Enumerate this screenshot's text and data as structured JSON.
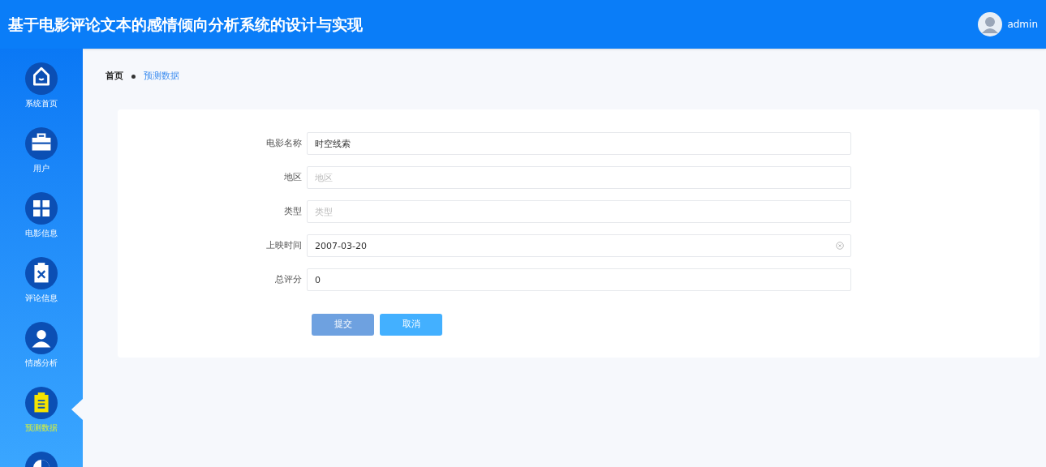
{
  "header": {
    "title": "基于电影评论文本的感情倾向分析系统的设计与实现",
    "user": "admin"
  },
  "sidebar": {
    "items": [
      {
        "label": "系统首页",
        "kind": "home",
        "selected": false
      },
      {
        "label": "用户",
        "kind": "briefcase",
        "selected": false
      },
      {
        "label": "电影信息",
        "kind": "grid",
        "selected": false
      },
      {
        "label": "评论信息",
        "kind": "clipboardx",
        "selected": false
      },
      {
        "label": "情感分析",
        "kind": "person",
        "selected": false
      },
      {
        "label": "预测数据",
        "kind": "clipboard",
        "selected": true
      },
      {
        "kind": "chart",
        "selected": false
      }
    ]
  },
  "breadcrumb": [
    "首页",
    "预测数据"
  ],
  "form": {
    "fields": [
      {
        "label": "电影名称",
        "kind": "text",
        "value": "时空线索"
      },
      {
        "label": "地区",
        "kind": "text",
        "placeholder": "地区"
      },
      {
        "label": "类型",
        "kind": "text",
        "placeholder": "类型"
      },
      {
        "label": "上映时间",
        "kind": "date",
        "value": "2007-03-20"
      },
      {
        "label": "总评分",
        "kind": "text",
        "value": "0"
      }
    ],
    "buttons": [
      {
        "label": "提交",
        "kind": "submit"
      },
      {
        "label": "取消",
        "kind": "cancel"
      }
    ]
  }
}
